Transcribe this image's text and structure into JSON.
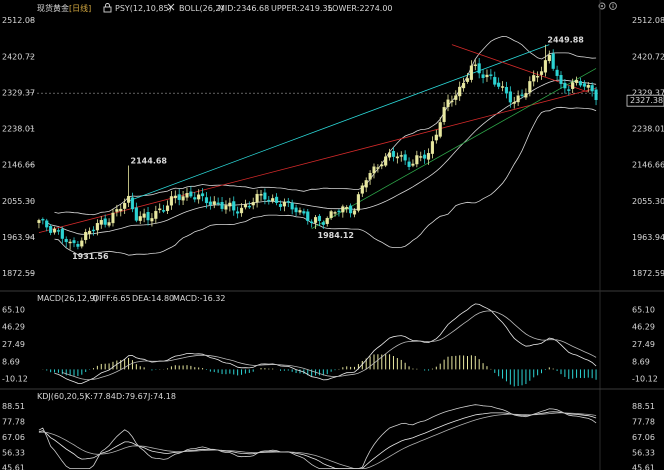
{
  "header": {
    "symbol": "现货黄金",
    "period": "[日线]",
    "psy": "PSY(12,10,85)",
    "boll": "BOLL(26,2)",
    "mid": "MID:2346.68",
    "upper": "UPPER:2419.35",
    "lower": "LOWER:2274.00"
  },
  "icons": [
    "lock-icon",
    "close-icon",
    "settings-icon",
    "info-icon"
  ],
  "last_price": "2327.38",
  "colors": {
    "up": "#e03a3a",
    "down": "#2cd3d3",
    "hollow_up": "#e8e8a0",
    "boll": "#d8d8d8",
    "macd_pos": "#e8e8a0",
    "macd_neg": "#2cd3d3",
    "trend_cyan": "#2bd9d9",
    "trend_red": "#d42a2a",
    "trend_green": "#2ea84a",
    "label_yellow": "#f0e060",
    "label_cyan": "#4fe0e0"
  },
  "macd_header": {
    "name": "MACD(26,12,9)",
    "diff": "DIFF:6.65",
    "dea": "DEA:14.80",
    "macd": "MACD:-16.32"
  },
  "kdj_header": {
    "name": "KDJ(60,20,5)",
    "k": "K:77.84",
    "d": "D:79.67",
    "j": "J:74.18"
  },
  "chart_data": [
    {
      "type": "candlestick",
      "panel": "price",
      "ylim": [
        1830,
        2525
      ],
      "yticks_left": [
        "2512.08",
        "2420.72",
        "2329.37",
        "2238.01",
        "2146.66",
        "2055.30",
        "1963.94",
        "1872.59"
      ],
      "yticks_right": [
        "2512.08",
        "2420.72",
        "2329.37",
        "2238.01",
        "2146.66",
        "2055.30",
        "1963.94",
        "1872.59"
      ],
      "yticks_values": [
        2512.08,
        2420.72,
        2329.37,
        2238.01,
        2146.66,
        2055.3,
        1963.94,
        1872.59
      ],
      "annotations": [
        {
          "text": "2144.68",
          "index": 23,
          "value": 2144.68,
          "color": "yellow"
        },
        {
          "text": "1931.56",
          "index": 8,
          "value": 1931.56,
          "color": "cyan"
        },
        {
          "text": "1984.12",
          "index": 71,
          "value": 1984.12,
          "color": "cyan"
        },
        {
          "text": "2449.88",
          "index": 130,
          "value": 2449.88,
          "color": "yellow"
        }
      ],
      "trendlines": [
        {
          "color": "cyan",
          "from": [
            23,
            2055
          ],
          "to": [
            131,
            2450
          ]
        },
        {
          "color": "red",
          "from": [
            0,
            1975
          ],
          "to": [
            143,
            2340
          ]
        },
        {
          "color": "red",
          "from": [
            106,
            2450
          ],
          "to": [
            141,
            2330
          ]
        },
        {
          "color": "green",
          "from": [
            70,
            1985
          ],
          "to": [
            143,
            2390
          ]
        }
      ]
    },
    {
      "type": "bar",
      "panel": "macd",
      "yticks": [
        "65.10",
        "46.29",
        "27.49",
        "8.69",
        "-10.12"
      ],
      "yticks_values": [
        65.1,
        46.29,
        27.49,
        8.69,
        -10.12
      ],
      "ylim": [
        -18,
        72
      ]
    },
    {
      "type": "line",
      "panel": "kdj",
      "yticks": [
        "88.51",
        "77.78",
        "67.06",
        "56.33",
        "45.61"
      ],
      "yticks_values": [
        88.51,
        77.78,
        67.06,
        56.33,
        45.61
      ],
      "ylim": [
        44,
        92
      ]
    }
  ]
}
